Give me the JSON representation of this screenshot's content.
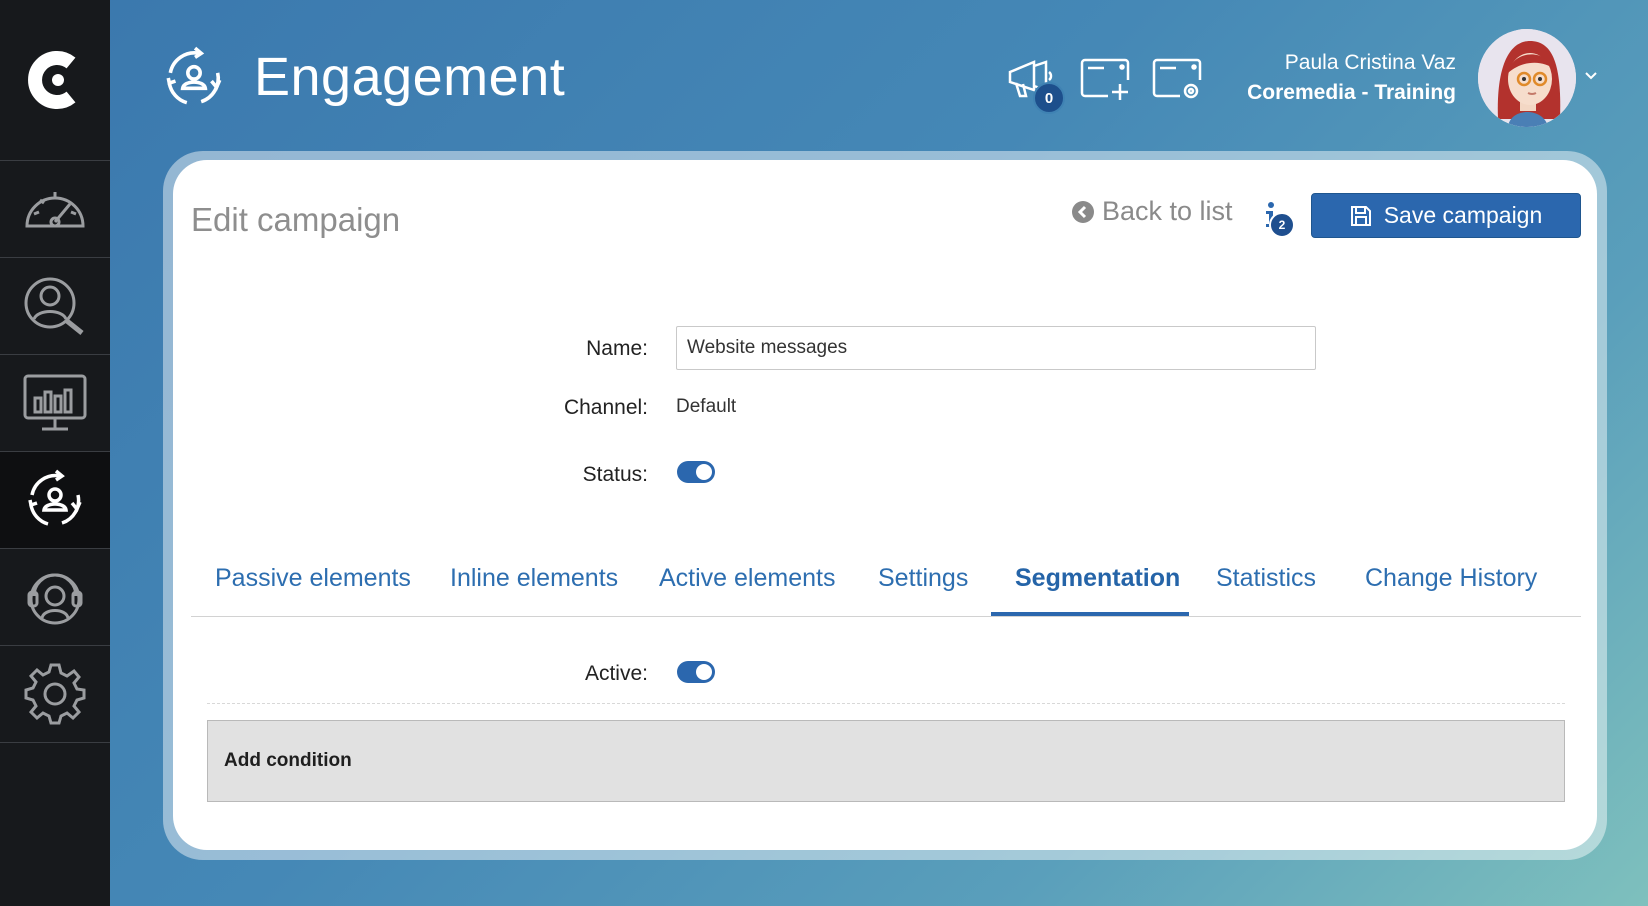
{
  "app": {
    "title": "Engagement",
    "logo_icon": "coremedia-logo-icon",
    "header_icon": "engagement-cycle-icon"
  },
  "sidebar": {
    "items": [
      {
        "name": "dashboard",
        "icon": "speedometer-icon",
        "active": false
      },
      {
        "name": "audience-search",
        "icon": "user-search-icon",
        "active": false
      },
      {
        "name": "analytics",
        "icon": "monitor-chart-icon",
        "active": false
      },
      {
        "name": "engagement",
        "icon": "engagement-cycle-icon",
        "active": true
      },
      {
        "name": "support",
        "icon": "headset-icon",
        "active": false
      },
      {
        "name": "settings",
        "icon": "gear-icon",
        "active": false
      }
    ]
  },
  "header": {
    "tools": [
      {
        "name": "announcements",
        "icon": "megaphone-icon",
        "badge": "0"
      },
      {
        "name": "add-window",
        "icon": "window-add-icon"
      },
      {
        "name": "window-settings",
        "icon": "window-settings-icon"
      }
    ],
    "user": {
      "name": "Paula Cristina Vaz",
      "company": "Coremedia - Training"
    }
  },
  "card": {
    "title": "Edit campaign",
    "back_label": "Back to list",
    "info_badge": "2",
    "save_label": "Save campaign"
  },
  "form": {
    "name_label": "Name:",
    "name_value": "Website messages",
    "channel_label": "Channel:",
    "channel_value": "Default",
    "status_label": "Status:",
    "status_on": true
  },
  "tabs": [
    {
      "label": "Passive elements",
      "active": false
    },
    {
      "label": "Inline elements",
      "active": false
    },
    {
      "label": "Active elements",
      "active": false
    },
    {
      "label": "Settings",
      "active": false
    },
    {
      "label": "Segmentation",
      "active": true
    },
    {
      "label": "Statistics",
      "active": false
    },
    {
      "label": "Change History",
      "active": false
    }
  ],
  "segmentation": {
    "active_label": "Active:",
    "active_on": true,
    "add_condition_label": "Add condition"
  },
  "colors": {
    "accent": "#2b67ae",
    "sidebar_bg": "#17191c",
    "condition_bg": "#e1e1e1"
  }
}
